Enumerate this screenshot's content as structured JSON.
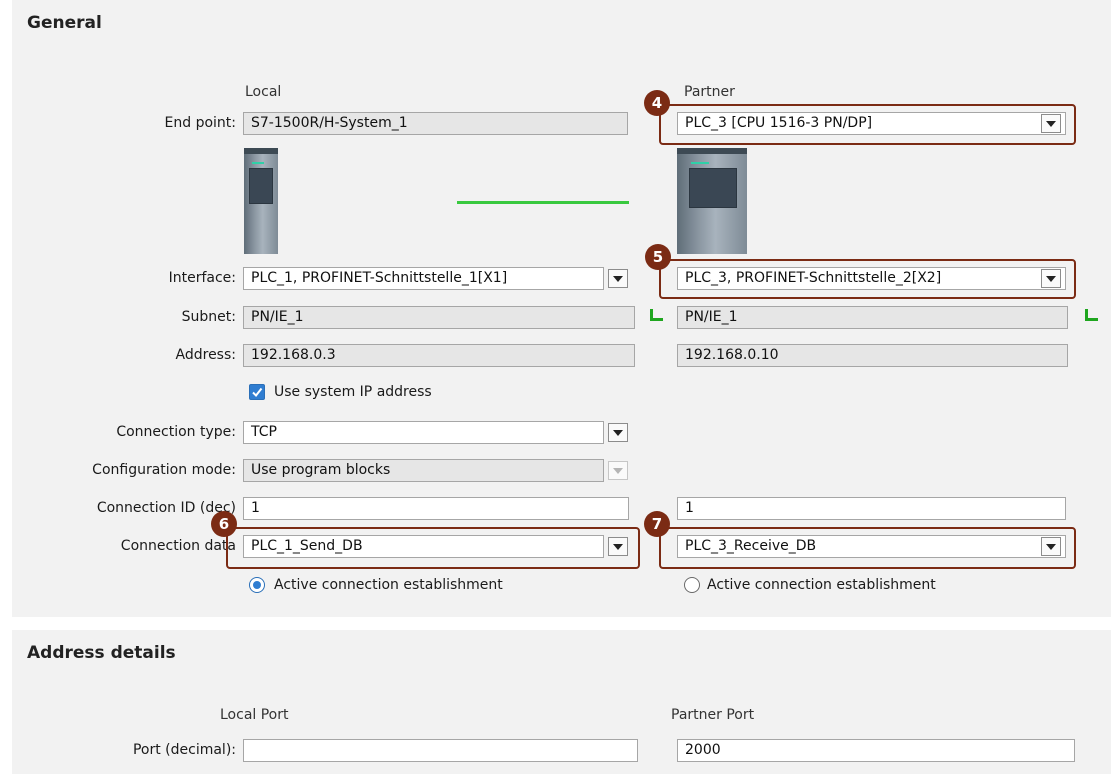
{
  "general": {
    "title": "General",
    "local_heading": "Local",
    "partner_heading": "Partner",
    "labels": {
      "end_point": "End point:",
      "interface": "Interface:",
      "subnet": "Subnet:",
      "address": "Address:",
      "connection_type": "Connection type:",
      "configuration_mode": "Configuration mode:",
      "connection_id": "Connection ID (dec)",
      "connection_data": "Connection data"
    },
    "local": {
      "end_point": "S7-1500R/H-System_1",
      "interface": "PLC_1, PROFINET-Schnittstelle_1[X1]",
      "subnet": "PN/IE_1",
      "address": "192.168.0.3",
      "connection_id": "1",
      "connection_data": "PLC_1_Send_DB",
      "active_establishment": "Active connection establishment",
      "active_selected": true
    },
    "partner": {
      "end_point": "PLC_3 [CPU 1516-3 PN/DP]",
      "interface": "PLC_3, PROFINET-Schnittstelle_2[X2]",
      "subnet": "PN/IE_1",
      "address": "192.168.0.10",
      "connection_id": "1",
      "connection_data": "PLC_3_Receive_DB",
      "active_establishment": "Active connection establishment",
      "active_selected": false
    },
    "use_system_ip": {
      "label": "Use system IP address",
      "checked": true
    },
    "connection_type": "TCP",
    "configuration_mode": "Use program blocks",
    "callouts": [
      "4",
      "5",
      "6",
      "7"
    ],
    "colors": {
      "callout": "#7b2b14",
      "connection_line": "#39c93f",
      "network_icon": "#1fa61f",
      "accent": "#2f7dd1"
    }
  },
  "address_details": {
    "title": "Address details",
    "local_port_heading": "Local Port",
    "partner_port_heading": "Partner Port",
    "port_label": "Port (decimal):",
    "local_port": "",
    "partner_port": "2000"
  }
}
